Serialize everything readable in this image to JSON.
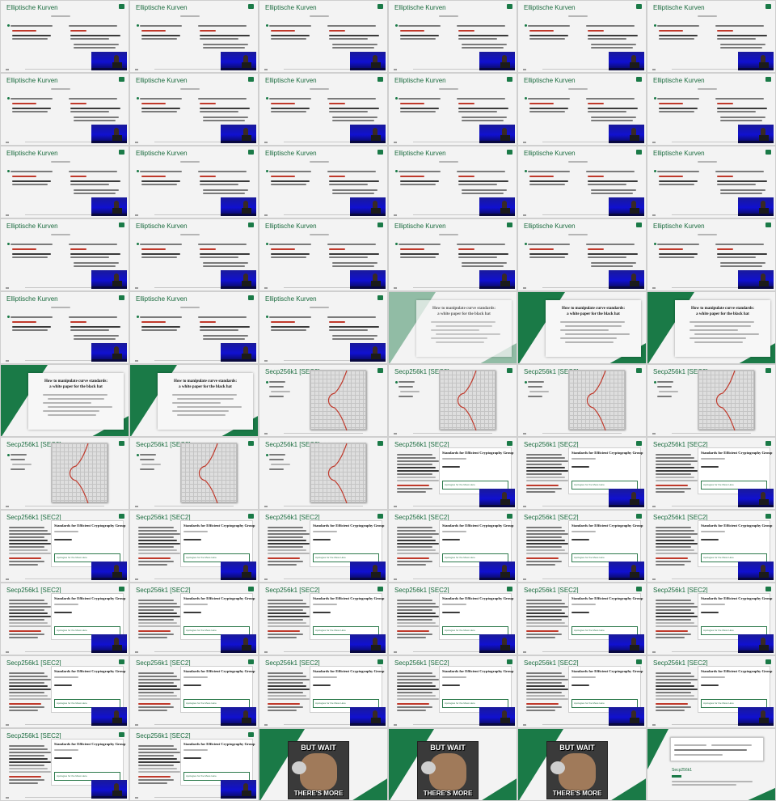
{
  "colors": {
    "accent": "#1a7a47",
    "red": "#c0392b",
    "video_blue": "#1010d0"
  },
  "titles": {
    "ek": "Elliptische Kurven",
    "secp": "Secp256k1 [SEC2]"
  },
  "paper": {
    "title_main": "How to manipulate curve standards:",
    "title_sub": "a white paper for the black hat",
    "secp_box_title": "Standards for Efficient Cryptography Group",
    "secp_box_label": "Apologies for the Mess Here"
  },
  "meme": {
    "top": "BUT WAIT",
    "bottom": "THERE'S MORE"
  },
  "last_slide": {
    "title": "Secp256k1"
  },
  "layout": [
    "ek",
    "ek",
    "ek",
    "ek",
    "ek",
    "ek",
    "ek",
    "ek",
    "ek",
    "ek",
    "ek",
    "ek",
    "ek",
    "ek",
    "ek",
    "ek",
    "ek",
    "ek",
    "ek",
    "ek",
    "ek",
    "ek",
    "ek",
    "ek",
    "ek",
    "ek",
    "ek",
    "paper-fade",
    "paper",
    "paper",
    "paper",
    "paper",
    "curve",
    "curve",
    "curve",
    "curve",
    "curve",
    "curve",
    "curve",
    "secp-doc",
    "secp-doc",
    "secp-doc",
    "secp-doc",
    "secp-doc",
    "secp-doc",
    "secp-doc",
    "secp-doc",
    "secp-doc",
    "secp-doc",
    "secp-doc",
    "secp-doc",
    "secp-doc",
    "secp-doc",
    "secp-doc",
    "secp-doc",
    "secp-doc",
    "secp-doc",
    "secp-doc",
    "secp-doc",
    "secp-doc",
    "secp-doc",
    "secp-doc",
    "meme",
    "meme",
    "meme",
    "last"
  ]
}
